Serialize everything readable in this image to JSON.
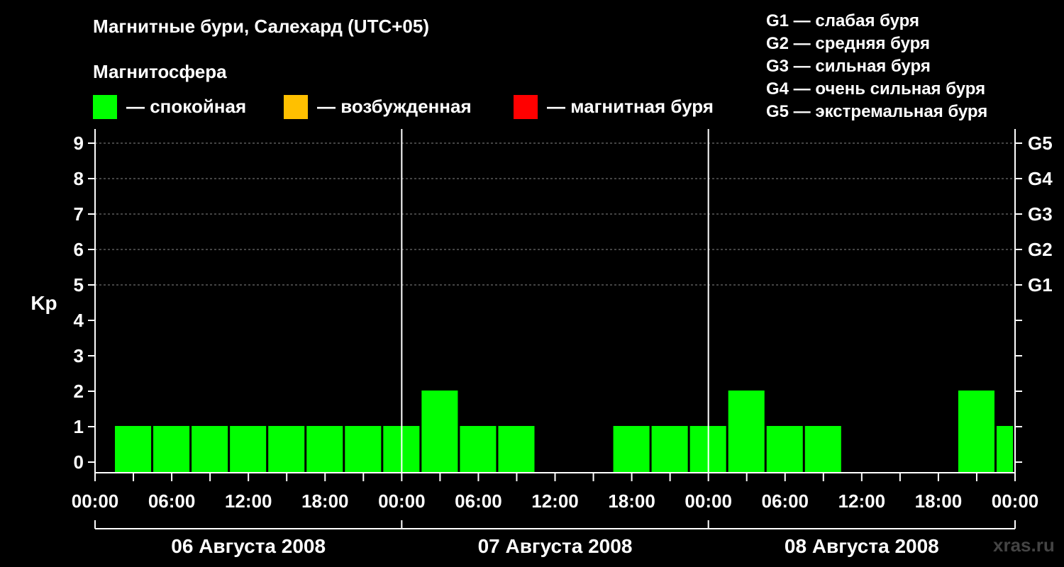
{
  "header": {
    "title": "Магнитные бури, Салехард (UTC+05)",
    "subtitle": "Магнитосфера"
  },
  "legend": [
    {
      "label": "— спокойная",
      "color": "#00ff00"
    },
    {
      "label": "— возбужденная",
      "color": "#ffc000"
    },
    {
      "label": "— магнитная буря",
      "color": "#ff0000"
    }
  ],
  "g_scale": [
    "G1 — слабая буря",
    "G2 — средняя буря",
    "G3 — сильная буря",
    "G4 — очень сильная буря",
    "G5 — экстремальная буря"
  ],
  "watermark": "xras.ru",
  "chart_data": {
    "type": "bar",
    "ylabel": "Kp",
    "ylim": [
      0,
      9
    ],
    "yticks": [
      "0",
      "1",
      "2",
      "3",
      "4",
      "5",
      "6",
      "7",
      "8",
      "9"
    ],
    "right_axis_labels": [
      {
        "kp": 5,
        "label": "G1"
      },
      {
        "kp": 6,
        "label": "G2"
      },
      {
        "kp": 7,
        "label": "G3"
      },
      {
        "kp": 8,
        "label": "G4"
      },
      {
        "kp": 9,
        "label": "G5"
      }
    ],
    "xtick_labels": [
      "00:00",
      "06:00",
      "12:00",
      "18:00",
      "00:00",
      "06:00",
      "12:00",
      "18:00",
      "00:00",
      "06:00",
      "12:00",
      "18:00",
      "00:00"
    ],
    "days": [
      "06 Августа 2008",
      "07 Августа 2008",
      "08 Августа 2008"
    ],
    "interval_hours": 3,
    "grid_levels": [
      5,
      6,
      7,
      8,
      9
    ],
    "values": [
      0,
      1,
      1,
      1,
      1,
      1,
      1,
      1,
      1,
      2,
      1,
      1,
      0,
      0,
      1,
      1,
      1,
      2,
      1,
      1,
      0,
      0,
      0,
      2,
      1
    ],
    "bar_color": "#00ff00"
  }
}
